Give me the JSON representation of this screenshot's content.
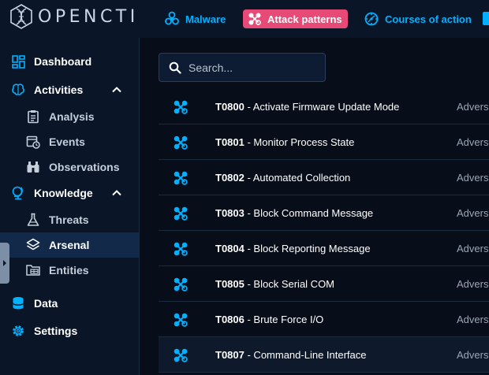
{
  "app": {
    "logo_text": "OPENCTI"
  },
  "topnav": [
    {
      "label": "Malware",
      "icon": "biohazard-icon"
    },
    {
      "label": "Attack patterns",
      "icon": "attack-pattern-icon",
      "active": true
    },
    {
      "label": "Courses of action",
      "icon": "course-of-action-icon"
    }
  ],
  "sidebar": {
    "dashboard": "Dashboard",
    "activities": "Activities",
    "analysis": "Analysis",
    "events": "Events",
    "observations": "Observations",
    "knowledge": "Knowledge",
    "threats": "Threats",
    "arsenal": "Arsenal",
    "entities": "Entities",
    "data": "Data",
    "settings": "Settings"
  },
  "search": {
    "placeholder": "Search..."
  },
  "rows": [
    {
      "id": "T0800",
      "name": " - Activate Firmware Update Mode",
      "type": "Advers"
    },
    {
      "id": "T0801",
      "name": " - Monitor Process State",
      "type": "Advers"
    },
    {
      "id": "T0802",
      "name": " - Automated Collection",
      "type": "Advers"
    },
    {
      "id": "T0803",
      "name": " - Block Command Message",
      "type": "Advers"
    },
    {
      "id": "T0804",
      "name": " - Block Reporting Message",
      "type": "Advers"
    },
    {
      "id": "T0805",
      "name": " - Block Serial COM",
      "type": "Advers"
    },
    {
      "id": "T0806",
      "name": " - Brute Force I/O",
      "type": "Advers"
    },
    {
      "id": "T0807",
      "name": " - Command-Line Interface",
      "type": "Advers"
    }
  ],
  "colors": {
    "accent": "#00b1ff",
    "active_tab": "#e84a78",
    "background": "#070d19",
    "panel": "#0a1628"
  }
}
